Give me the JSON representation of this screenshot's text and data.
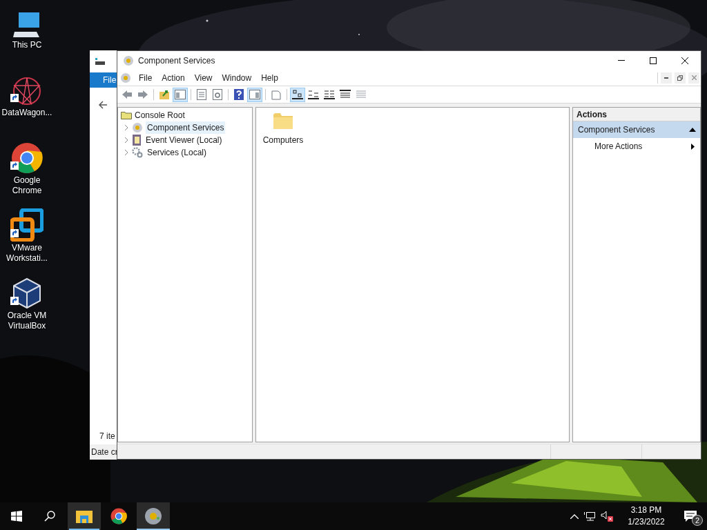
{
  "desktop_icons": [
    {
      "label": "This PC",
      "kind": "pc",
      "shortcut": false
    },
    {
      "label": "DataWagon...",
      "kind": "star",
      "shortcut": true
    },
    {
      "label": "Google Chrome",
      "kind": "chrome",
      "shortcut": true
    },
    {
      "label": "VMware Workstati...",
      "kind": "vmware",
      "shortcut": true
    },
    {
      "label": "Oracle VM VirtualBox",
      "kind": "cube",
      "shortcut": true
    }
  ],
  "background_window": {
    "ribbon_tab": "File",
    "status_text": "7 ite",
    "column_header": "Date cr"
  },
  "window": {
    "title": "Component Services",
    "menu": [
      "File",
      "Action",
      "View",
      "Window",
      "Help"
    ],
    "toolbar": [
      {
        "kind": "back",
        "pressed": false
      },
      {
        "kind": "forward",
        "pressed": false
      },
      {
        "kind": "sep"
      },
      {
        "kind": "up",
        "pressed": false
      },
      {
        "kind": "tree",
        "pressed": true
      },
      {
        "kind": "sep"
      },
      {
        "kind": "sheet",
        "pressed": false
      },
      {
        "kind": "refresh",
        "pressed": false
      },
      {
        "kind": "sep"
      },
      {
        "kind": "help",
        "pressed": false
      },
      {
        "kind": "pane",
        "pressed": true
      },
      {
        "kind": "sep"
      },
      {
        "kind": "newwin",
        "pressed": false
      },
      {
        "kind": "sep"
      },
      {
        "kind": "large",
        "pressed": true
      },
      {
        "kind": "small",
        "pressed": false
      },
      {
        "kind": "list",
        "pressed": false
      },
      {
        "kind": "details",
        "pressed": false
      },
      {
        "kind": "custom",
        "pressed": false
      }
    ],
    "tree": {
      "label": "Console Root",
      "children": [
        {
          "label": "Component Services",
          "kind": "component",
          "expanded": false,
          "selected": true
        },
        {
          "label": "Event Viewer (Local)",
          "kind": "book",
          "expanded": false,
          "selected": false
        },
        {
          "label": "Services (Local)",
          "kind": "gear",
          "expanded": false,
          "selected": false
        }
      ]
    },
    "content_items": [
      {
        "label": "Computers",
        "kind": "folder"
      }
    ],
    "actions": {
      "title": "Actions",
      "sections": [
        {
          "label": "Component Services",
          "expanded": true,
          "items": [
            {
              "label": "More Actions",
              "submenu": true
            }
          ]
        }
      ]
    }
  },
  "taskbar": {
    "apps": [
      {
        "kind": "explorer",
        "running": true,
        "selected": false
      },
      {
        "kind": "chrome",
        "running": false,
        "selected": false
      },
      {
        "kind": "component",
        "running": true,
        "selected": true
      }
    ],
    "time": "3:18 PM",
    "date": "1/23/2022",
    "notifications": "2"
  }
}
